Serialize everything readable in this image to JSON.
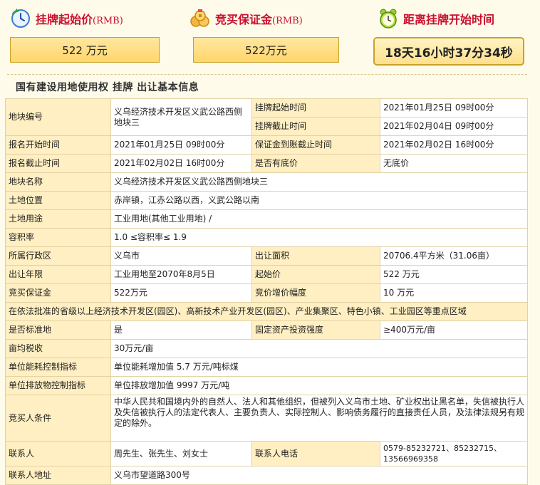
{
  "summary": {
    "start_price": {
      "title": "挂牌起始价",
      "unit": "(RMB)",
      "value": "522 万元",
      "icon": "clock-refresh-icon"
    },
    "deposit": {
      "title": "竞买保证金",
      "unit": "(RMB)",
      "value": "522万元",
      "icon": "coins-icon"
    },
    "countdown": {
      "title": "距离挂牌开始时间",
      "value": "18天16小时37分34秒",
      "icon": "alarm-clock-icon"
    }
  },
  "section_title": "国有建设用地使用权 挂牌 出让基本信息",
  "table": {
    "plot_no_label": "地块编号",
    "plot_no_value": "义乌经济技术开发区义武公路西侧地块三",
    "listing_start_label": "挂牌起始时间",
    "listing_start_value": "2021年01月25日 09时00分",
    "listing_end_label": "挂牌截止时间",
    "listing_end_value": "2021年02月04日 09时00分",
    "reg_start_label": "报名开始时间",
    "reg_start_value": "2021年01月25日 09时00分",
    "deposit_deadline_label": "保证金到账截止时间",
    "deposit_deadline_value": "2021年02月02日 16时00分",
    "reg_end_label": "报名截止时间",
    "reg_end_value": "2021年02月02日 16时00分",
    "reserve_label": "是否有底价",
    "reserve_value": "无底价",
    "plot_name_label": "地块名称",
    "plot_name_value": "义乌经济技术开发区义武公路西侧地块三",
    "location_label": "土地位置",
    "location_value": "赤岸镇，江赤公路以西，义武公路以南",
    "use_label": "土地用途",
    "use_value": "工业用地(其他工业用地) /",
    "far_label": "容积率",
    "far_value": "1.0 ≤容积率≤ 1.9",
    "district_label": "所属行政区",
    "district_value": "义乌市",
    "area_label": "出让面积",
    "area_value": "20706.4平方米（31.06亩）",
    "term_label": "出让年限",
    "term_value": "工业用地至2070年8月5日",
    "start_price_label": "起始价",
    "start_price_value": "522 万元",
    "bid_deposit_label": "竞买保证金",
    "bid_deposit_value": "522万元",
    "increment_label": "竞价增价幅度",
    "increment_value": "10 万元",
    "zone_note": "在依法批准的省级以上经济技术开发区(园区)、高新技术产业开发区(园区)、产业集聚区、特色小镇、工业园区等重点区域",
    "standard_label": "是否标准地",
    "standard_value": "是",
    "fixed_invest_label": "固定资产投资强度",
    "fixed_invest_value": "≥400万元/亩",
    "tax_label": "亩均税收",
    "tax_value": "30万元/亩",
    "energy_label": "单位能耗控制指标",
    "energy_value": "单位能耗增加值 5.7 万元/吨标煤",
    "emission_label": "单位排放物控制指标",
    "emission_value": "单位排放增加值 9997 万元/吨",
    "bidder_label": "竞买人条件",
    "bidder_value": "中华人民共和国境内外的自然人、法人和其他组织，但被列入义乌市土地、矿业权出让黑名单，失信被执行人及失信被执行人的法定代表人、主要负责人、实际控制人、影响债务履行的直接责任人员，及法律法规另有规定的除外。",
    "contact_label": "联系人",
    "contact_value": "周先生、张先生、刘女士",
    "phone_label": "联系人电话",
    "phone_value": "0579-85232721、85232715、13566969358",
    "address_label": "联系人地址",
    "address_value": "义乌市望道路300号"
  },
  "colors": {
    "accent_red": "#c8102e",
    "label_bg": "#ffefc2",
    "box_bg": "#ffd66c",
    "border": "#e2d3a6"
  }
}
